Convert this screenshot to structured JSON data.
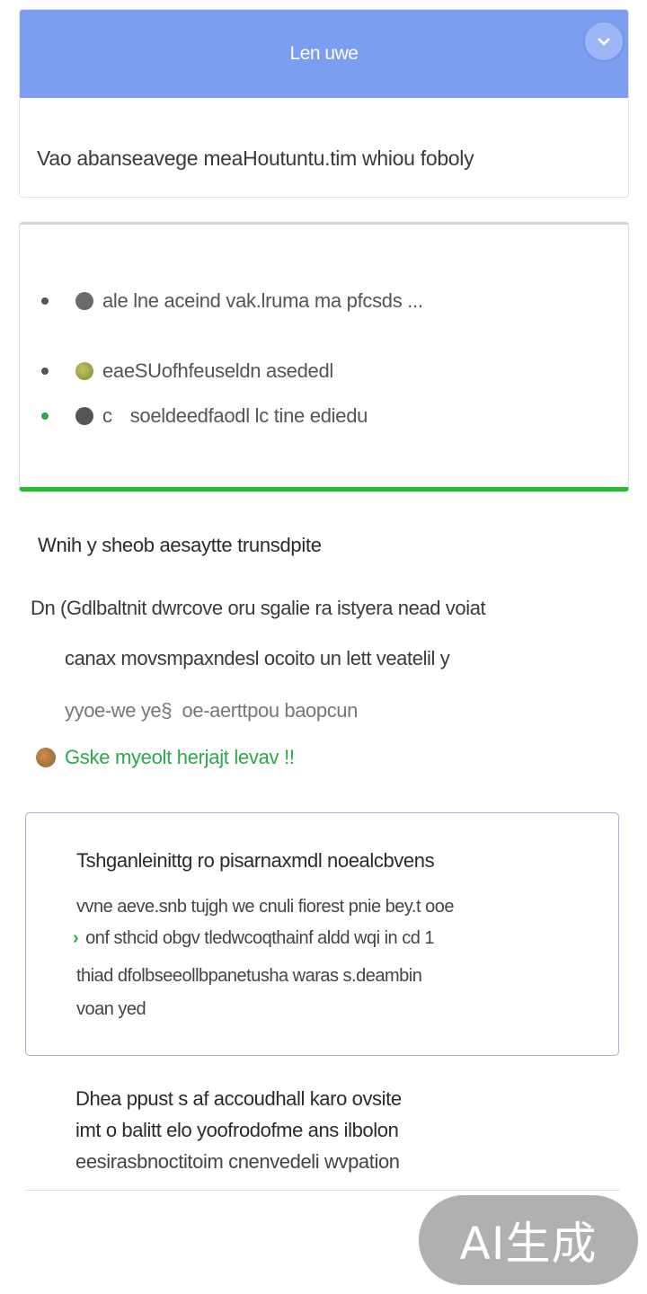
{
  "header": {
    "title": "Len uwe",
    "collapse_icon": "chevron-down-icon",
    "body_text": "Vao abanseavege meaHoutuntu.tim whiou foboly"
  },
  "bullets": [
    {
      "icon": "gray-circle-icon",
      "prefix": "",
      "text": "ale lne aceind vak.lruma ma pfcsds ..."
    },
    {
      "icon": "olive-circle-icon",
      "prefix": "",
      "text": "eaeSUofhfeuseldn asededl"
    },
    {
      "icon": "dark-circle-icon",
      "prefix": "c",
      "text": "soeldeedfaodl lc tine ediedu"
    }
  ],
  "section": {
    "heading": "Wnih y sheob aesaytte trunsdpite",
    "lines": [
      "Dn (Gdlbaltnit dwrcove oru sgalie ra istyera  nead voiat",
      "canax movsmpaxndesl ocoito un lett veatelil y",
      "yyoe-we ye§  oe-aerttpou baopcun"
    ],
    "status": "Gske myeolt herjajt levav !!"
  },
  "info_card": {
    "title": "Tshganleinittg ro pisarnaxmdl noealcbvens",
    "lines": [
      "vvne aeve.snb tujgh we cnuli fiorest pnie bey.t ooe",
      "onf sthcid obgv tledwcoqthainf aldd wqi  in cd 1",
      "thiad dfolbseeollbpanetusha waras s.deambin",
      "voan yed"
    ]
  },
  "bottom": {
    "lines": [
      "Dhea ppust s af accoudhall karo ovsite",
      "imt o balitt elo yoofrodofme ans  ilbolon",
      "eesirasbnoctitoim cnenvedeli wvpation"
    ]
  },
  "watermark": "AI生成"
}
